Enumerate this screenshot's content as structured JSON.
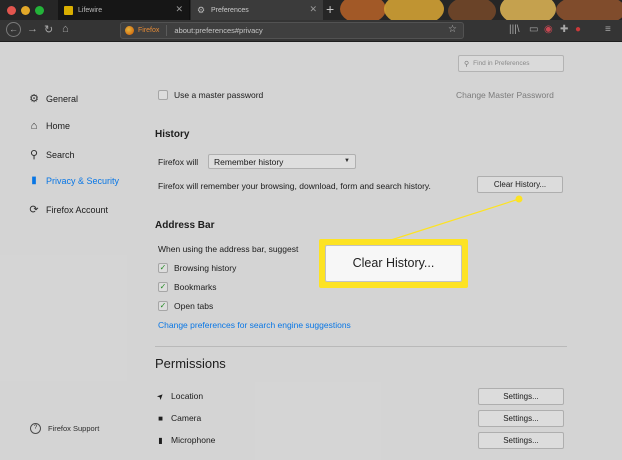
{
  "browser": {
    "tabs": [
      {
        "label": "Lifewire",
        "favicon_color": "#f2c200"
      },
      {
        "label": "Preferences",
        "active": true
      }
    ],
    "new_tab_symbol": "+",
    "url_identity": "Firefox",
    "url": "about:preferences#privacy"
  },
  "sidebar": {
    "items": [
      {
        "label": "General",
        "icon": "gear-icon",
        "glyph": "⚙"
      },
      {
        "label": "Home",
        "icon": "home-icon",
        "glyph": "⌂"
      },
      {
        "label": "Search",
        "icon": "search-icon",
        "glyph": "⚲"
      },
      {
        "label": "Privacy & Security",
        "icon": "lock-icon",
        "glyph": "🔒",
        "active": true
      },
      {
        "label": "Firefox Account",
        "icon": "sync-icon",
        "glyph": "⟳"
      }
    ],
    "support_label": "Firefox Support"
  },
  "search": {
    "placeholder": "Find in Preferences"
  },
  "master_password": {
    "label": "Use a master password",
    "change_label": "Change Master Password",
    "checked": false
  },
  "history": {
    "heading": "History",
    "firefox_will_label": "Firefox will",
    "dropdown_value": "Remember history",
    "description": "Firefox will remember your browsing, download, form and search history.",
    "clear_button": "Clear History..."
  },
  "address_bar": {
    "heading": "Address Bar",
    "intro": "When using the address bar, suggest",
    "options": [
      {
        "label": "Browsing history",
        "checked": true
      },
      {
        "label": "Bookmarks",
        "checked": true
      },
      {
        "label": "Open tabs",
        "checked": true
      }
    ],
    "link": "Change preferences for search engine suggestions"
  },
  "permissions": {
    "heading": "Permissions",
    "rows": [
      {
        "label": "Location",
        "icon": "location-arrow-icon",
        "glyph": "➤",
        "button": "Settings..."
      },
      {
        "label": "Camera",
        "icon": "camera-icon",
        "glyph": "■",
        "button": "Settings..."
      },
      {
        "label": "Microphone",
        "icon": "microphone-icon",
        "glyph": "🎙",
        "button": "Settings..."
      }
    ]
  },
  "callout": {
    "button_label": "Clear History...",
    "highlight_color": "#fde323"
  },
  "colors": {
    "accent": "#0a84ff",
    "check": "#2a9b2a",
    "callout": "#fde323"
  }
}
